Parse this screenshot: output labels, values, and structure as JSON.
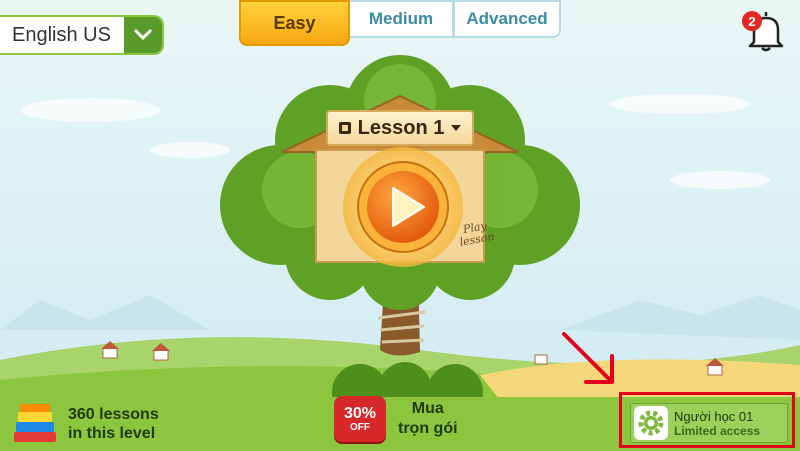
{
  "language": {
    "selected": "English US"
  },
  "level_tabs": [
    {
      "label": "Easy",
      "active": true
    },
    {
      "label": "Medium",
      "active": false
    },
    {
      "label": "Advanced",
      "active": false
    }
  ],
  "notifications": {
    "count": "2"
  },
  "lesson": {
    "title": "Lesson 1",
    "play_label_line1": "Play",
    "play_label_line2": "lesson"
  },
  "footer": {
    "lessons_line1": "360 lessons",
    "lessons_line2": "in this level",
    "discount_pct": "30%",
    "discount_off": "OFF",
    "buy_line1": "Mua",
    "buy_line2": "trọn gói"
  },
  "account": {
    "name": "Người học 01",
    "status": "Limited access"
  },
  "colors": {
    "accent_green": "#8cc63f",
    "tab_active": "#f7a810",
    "highlight_red": "#e3001b",
    "badge_red": "#e52424"
  }
}
